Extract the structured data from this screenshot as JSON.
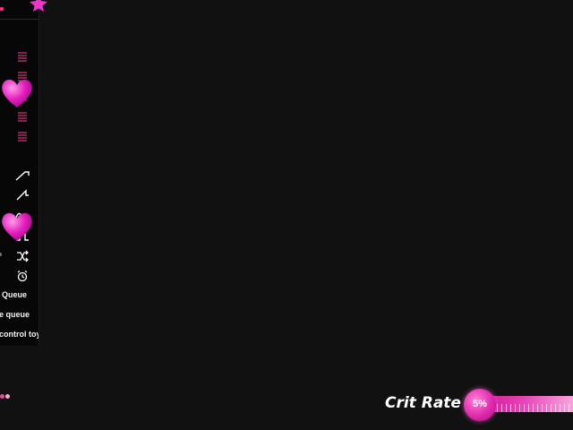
{
  "sidebar": {
    "items": [
      {
        "label": "Queue",
        "icon": "queue-icon"
      },
      {
        "label": "e queue",
        "icon": "clear-queue-icon"
      },
      {
        "label": "control toy",
        "icon": "control-toy-icon"
      }
    ],
    "list_icons": [
      "list-icon",
      "list-icon",
      "list-icon",
      "list-icon",
      "list-icon"
    ],
    "pattern_icons": [
      "ramp-up-icon",
      "step-up-icon",
      "wave-icon",
      "pulse-icon",
      "shuffle-icon",
      "alarm-clock-icon"
    ]
  },
  "crit_rate": {
    "label": "Crit Rate",
    "value_label": "5%",
    "value": 5
  },
  "colors": {
    "accent": "#e02aae",
    "background": "#111111",
    "panel": "#070707"
  }
}
